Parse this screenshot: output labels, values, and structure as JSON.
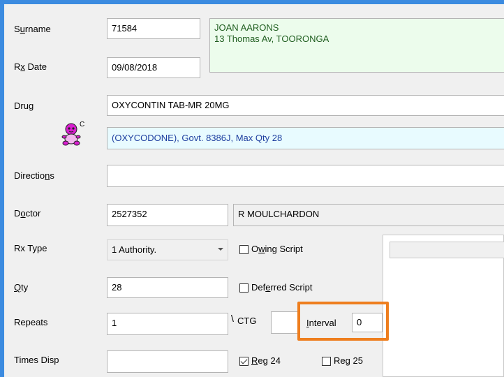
{
  "labels": {
    "surname": "Surname",
    "rx_date": "Rx Date",
    "drug": "Drug",
    "directions": "Directions",
    "doctor": "Doctor",
    "rx_type": "Rx Type",
    "qty": "Qty",
    "repeats": "Repeats",
    "times_disp": "Times Disp"
  },
  "values": {
    "surname": "71584",
    "patient_name": "JOAN AARONS",
    "patient_address": "13 Thomas Av, TOORONGA",
    "rx_date": "09/08/2018",
    "drug": "OXYCONTIN TAB-MR 20MG",
    "drug_info": "(OXYCODONE), Govt. 8386J,  Max Qty 28",
    "directions": "",
    "doctor_code": "2527352",
    "doctor_name": "R MOULCHARDON",
    "rx_type": "1 Authority.",
    "qty": "28",
    "repeats": "1",
    "ctg": "",
    "interval": "0",
    "times_disp": ""
  },
  "checkboxes": {
    "owing_script": {
      "label": "Owing Script",
      "checked": false
    },
    "deferred_script": {
      "label": "Deferred Script",
      "checked": false
    },
    "reg24": {
      "label": "Reg 24",
      "checked": true
    },
    "reg25": {
      "label": "Reg 25",
      "checked": false
    }
  },
  "ctg_label": "CTG",
  "interval_label": "Interval",
  "schedule_icon": {
    "name": "baby-controlled-drug-icon",
    "badge": "C",
    "color": "#d81ecf"
  }
}
